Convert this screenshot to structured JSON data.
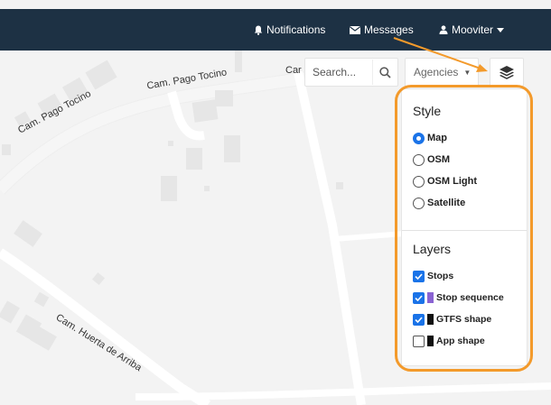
{
  "navbar": {
    "notifications_label": "Notifications",
    "messages_label": "Messages",
    "user_label": "Mooviter"
  },
  "map": {
    "street_labels": {
      "cam_pago_tocino_1": "Cam. Pago Tocino",
      "cam_pago_tocino_2": "Cam. Pago Tocino",
      "cam_partial": "Car",
      "cam_huerta": "Cam. Huerta de Arriba"
    }
  },
  "controls": {
    "search_placeholder": "Search...",
    "agency_label": "Agencies",
    "agency_caret": "▼"
  },
  "panel": {
    "style_title": "Style",
    "styles": [
      {
        "label": "Map",
        "checked": true
      },
      {
        "label": "OSM",
        "checked": false
      },
      {
        "label": "OSM Light",
        "checked": false
      },
      {
        "label": "Satellite",
        "checked": false
      }
    ],
    "layers_title": "Layers",
    "layers": [
      {
        "label": "Stops",
        "checked": true,
        "swatch": ""
      },
      {
        "label": "Stop sequence",
        "checked": true,
        "swatch": "#8a63d2"
      },
      {
        "label": "GTFS shape",
        "checked": true,
        "swatch": "#111111"
      },
      {
        "label": "App shape",
        "checked": false,
        "swatch": "#111111"
      }
    ]
  },
  "colors": {
    "navbar": "#1d3144",
    "accent": "#1a73e8",
    "highlight": "#f39a2b"
  }
}
